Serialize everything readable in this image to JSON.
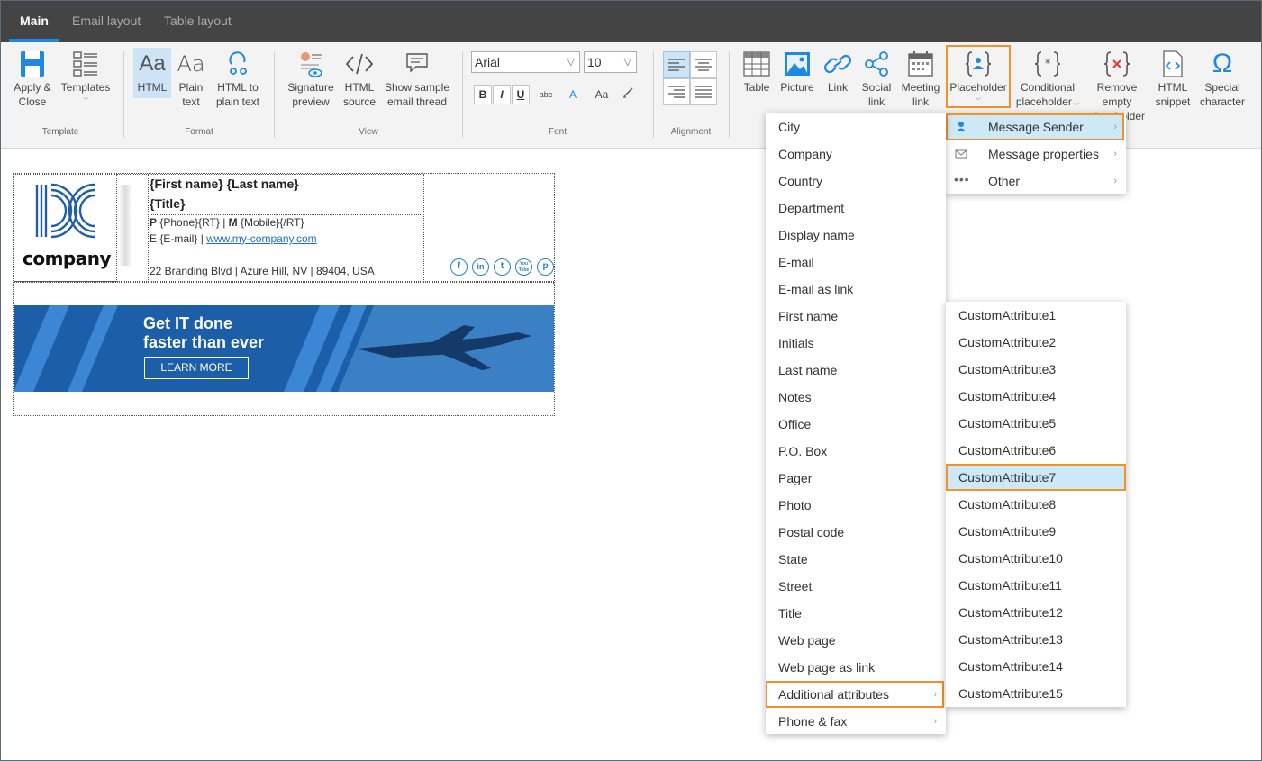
{
  "tabs": [
    {
      "label": "Main",
      "active": true
    },
    {
      "label": "Email layout",
      "active": false
    },
    {
      "label": "Table layout",
      "active": false
    }
  ],
  "ribbon": {
    "template": {
      "label": "Template",
      "apply_close": {
        "line1": "Apply &",
        "line2": "Close",
        "icon": "save-icon"
      },
      "templates": {
        "line1": "Templates",
        "icon": "templates-icon"
      }
    },
    "format": {
      "label": "Format",
      "html": {
        "line1": "HTML",
        "icon": "html-format-icon"
      },
      "plain": {
        "line1": "Plain",
        "line2": "text",
        "icon": "plain-text-icon"
      },
      "html_to_plain": {
        "line1": "HTML to",
        "line2": "plain text",
        "icon": "convert-icon"
      }
    },
    "view": {
      "label": "View",
      "signature_preview": {
        "line1": "Signature",
        "line2": "preview"
      },
      "html_source": {
        "line1": "HTML",
        "line2": "source"
      },
      "sample_thread": {
        "line1": "Show sample",
        "line2": "email thread"
      }
    },
    "font": {
      "label": "Font",
      "family": "Arial",
      "size": "10",
      "bold": "B",
      "italic": "I",
      "underline": "U",
      "strike": "abc",
      "color": "A",
      "case": "Aa"
    },
    "alignment": {
      "label": "Alignment"
    },
    "insert": {
      "table": {
        "line1": "Table"
      },
      "picture": {
        "line1": "Picture"
      },
      "link": {
        "line1": "Link"
      },
      "social": {
        "line1": "Social",
        "line2": "link"
      },
      "meeting": {
        "line1": "Meeting",
        "line2": "link"
      },
      "placeholder": {
        "line1": "Placeholder"
      },
      "conditional": {
        "line1": "Conditional",
        "line2": "placeholder"
      },
      "remove_empty": {
        "line1": "Remove",
        "line2": "empty",
        "line3": "placeholder"
      },
      "html_snippet": {
        "line1": "HTML",
        "line2": "snippet"
      },
      "special": {
        "line1": "Special",
        "line2": "character"
      }
    }
  },
  "signature": {
    "logo_text": "company",
    "name_line": "{First name} {Last name}",
    "title_line": "{Title}",
    "phone_p": "P",
    "phone_value": " {Phone}{RT} | ",
    "mobile_m": "M",
    "mobile_value": " {Mobile}{/RT}",
    "email_e": "E {E-mail} | ",
    "website": "www.my-company.com",
    "address": "22 Branding Blvd | Azure Hill, NV | 89404, USA",
    "social_icons": [
      "f",
      "in",
      "t",
      "You Tube",
      "p"
    ],
    "banner_line1": "Get IT done",
    "banner_line2": "faster than ever",
    "banner_button": "LEARN MORE"
  },
  "placeholder_menu": [
    {
      "label": "Message Sender",
      "icon": "person-icon",
      "highlight": true
    },
    {
      "label": "Message properties",
      "icon": "envelope-icon"
    },
    {
      "label": "Other",
      "icon": "ellipsis-icon"
    }
  ],
  "sender_menu": [
    "City",
    "Company",
    "Country",
    "Department",
    "Display name",
    "E-mail",
    "E-mail as link",
    "First name",
    "Initials",
    "Last name",
    "Notes",
    "Office",
    "P.O. Box",
    "Pager",
    "Photo",
    "Postal code",
    "State",
    "Street",
    "Title",
    "Web page",
    "Web page as link",
    "Additional attributes",
    "Phone & fax"
  ],
  "attributes_menu": [
    "CustomAttribute1",
    "CustomAttribute2",
    "CustomAttribute3",
    "CustomAttribute4",
    "CustomAttribute5",
    "CustomAttribute6",
    "CustomAttribute7",
    "CustomAttribute8",
    "CustomAttribute9",
    "CustomAttribute10",
    "CustomAttribute11",
    "CustomAttribute12",
    "CustomAttribute13",
    "CustomAttribute14",
    "CustomAttribute15"
  ],
  "colors": {
    "accent": "#1e88e5",
    "highlight_box": "#f0932b",
    "menu_highlight": "#cde8f7"
  }
}
